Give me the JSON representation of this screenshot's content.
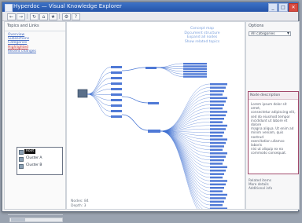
{
  "window": {
    "title": "Hyperdoc — Visual Knowledge Explorer",
    "buttons": [
      "_",
      "□",
      "✕"
    ]
  },
  "toolbar": {
    "buttons": [
      "←",
      "→",
      "↻",
      "⌂",
      "★",
      "⚙",
      "?"
    ]
  },
  "left_panel": {
    "header": "Topics and Links",
    "links": [
      {
        "text": "Overview"
      },
      {
        "text": "Subsections"
      },
      {
        "text": "Categories"
      },
      {
        "text": "Highlighted",
        "style": "red"
      },
      {
        "text": "Recent changes"
      }
    ],
    "tree": [
      {
        "label": "Root",
        "selected": true
      },
      {
        "label": "Cluster A"
      },
      {
        "label": "Cluster B"
      }
    ]
  },
  "center": {
    "top_links": [
      "Concept map",
      "Document structure",
      "Expand all nodes",
      "Show related topics"
    ],
    "footer_lines": [
      "Nodes: 84",
      "Depth: 3"
    ],
    "graph": {
      "colors": {
        "edge": "#3d6ed1",
        "node": "#4f79d6",
        "root": "#5a6f8a"
      },
      "groups": [
        {
          "name": "group1",
          "count": 10
        },
        {
          "name": "group2",
          "count": 6
        },
        {
          "name": "group3",
          "count": 40
        }
      ]
    }
  },
  "right_panel": {
    "header": "Options",
    "select_value": "All categories",
    "desc_title": "Node description",
    "desc_text": "Lorem ipsum dolor sit amet,\nconsectetur adipiscing elit,\nsed do eiusmod tempor\nincididunt ut labore et dolore\nmagna aliqua. Ut enim ad\nminim veniam, quis nostrud\nexercitation ullamco laboris\nnisi ut aliquip ex ea\ncommodo consequat.",
    "extra_lines": [
      "Related items",
      "More details",
      "Additional info"
    ]
  }
}
